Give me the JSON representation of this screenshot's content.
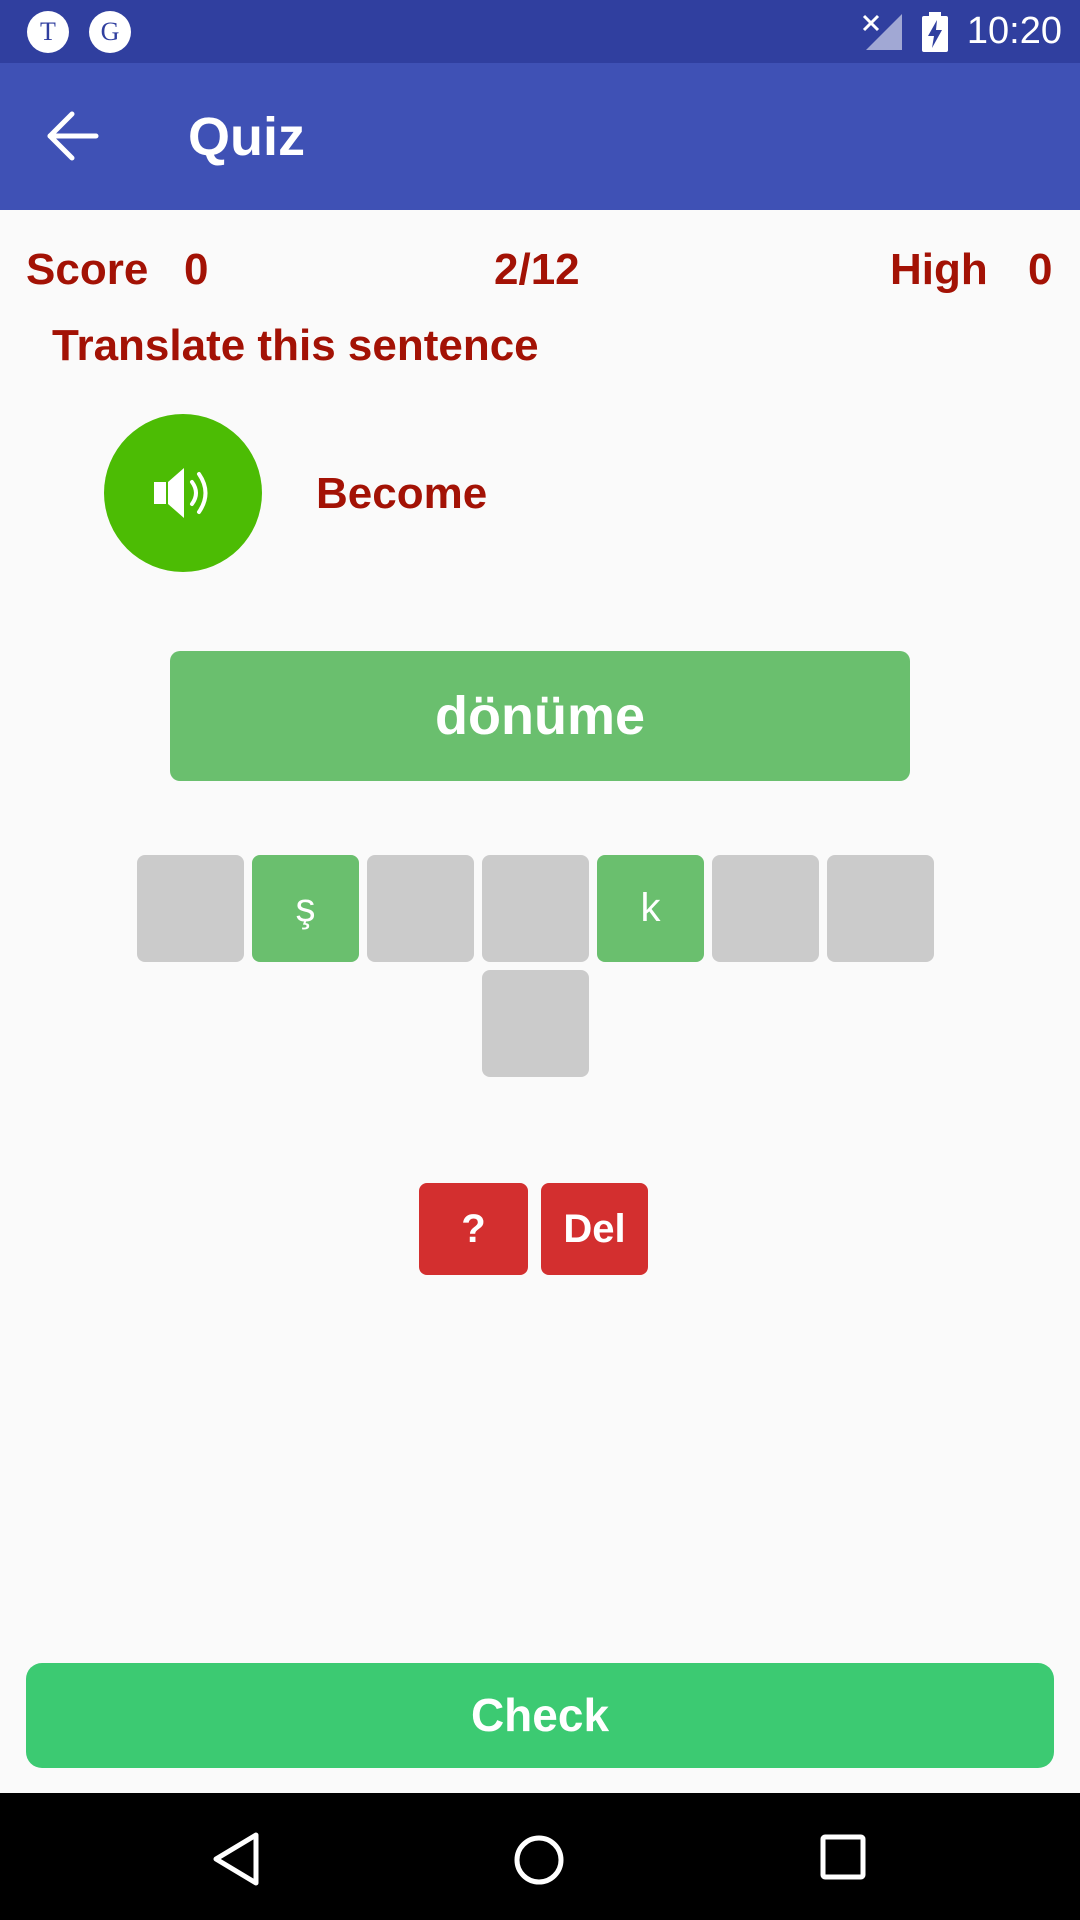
{
  "status_bar": {
    "notifications": [
      {
        "letter": "T",
        "icon": "t-notification-icon"
      },
      {
        "letter": "G",
        "icon": "g-notification-icon"
      }
    ],
    "time": "10:20",
    "icons": [
      "signal-no-service-icon",
      "battery-charging-icon"
    ]
  },
  "app_bar": {
    "title": "Quiz",
    "back_icon": "back-arrow-icon"
  },
  "score": {
    "label": "Score",
    "value": "0",
    "progress": "2/12",
    "high_label": "High",
    "high_value": "0"
  },
  "prompt": "Translate this sentence",
  "speaker_icon": "speaker-icon",
  "word": "Become",
  "answer": "dönüme",
  "tiles": [
    "",
    "ş",
    "",
    "",
    "k",
    "",
    "",
    ""
  ],
  "buttons": {
    "hint": "?",
    "delete": "Del",
    "check": "Check"
  },
  "colors": {
    "status_bar": "#303f9f",
    "app_bar": "#3f51b5",
    "text_red": "#a31205",
    "speaker_green": "#4cbc04",
    "answer_green": "#6abf6e",
    "tile_grey": "#cbcbcb",
    "action_red": "#d32f2f",
    "check_green": "#3cca72"
  }
}
